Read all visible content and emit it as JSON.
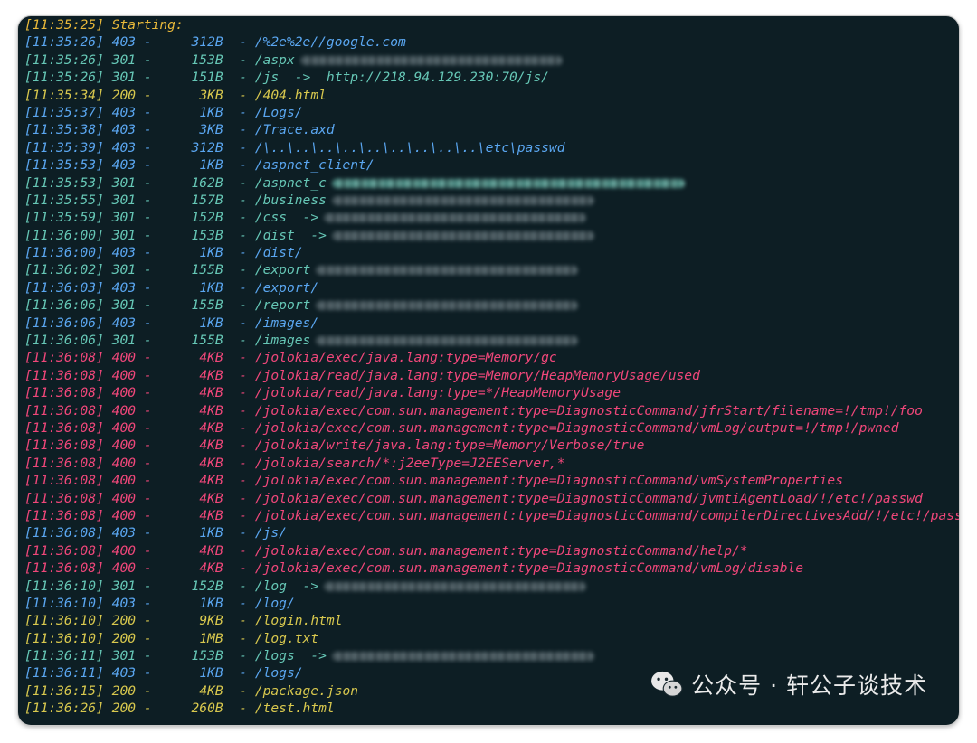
{
  "header": {
    "text": "[11:35:25] Starting:"
  },
  "lines": [
    {
      "time": "[11:35:26]",
      "status": "403",
      "size": "312B",
      "path": "/%2e%2e//google.com",
      "color": "blue",
      "redacted": 0
    },
    {
      "time": "[11:35:26]",
      "status": "301",
      "size": "153B",
      "path": "/aspx",
      "color": "teal",
      "redacted": 1
    },
    {
      "time": "[11:35:26]",
      "status": "301",
      "size": "151B",
      "path": "/js  ->  http://218.94.129.230:70/js/",
      "color": "teal",
      "redacted": 0
    },
    {
      "time": "[11:35:34]",
      "status": "200",
      "size": "3KB",
      "path": "/404.html",
      "color": "yellow",
      "redacted": 0
    },
    {
      "time": "[11:35:37]",
      "status": "403",
      "size": "1KB",
      "path": "/Logs/",
      "color": "blue",
      "redacted": 0
    },
    {
      "time": "[11:35:38]",
      "status": "403",
      "size": "3KB",
      "path": "/Trace.axd",
      "color": "blue",
      "redacted": 0
    },
    {
      "time": "[11:35:39]",
      "status": "403",
      "size": "312B",
      "path": "/\\..\\..\\..\\..\\..\\..\\..\\..\\..\\etc\\passwd",
      "color": "blue",
      "redacted": 0
    },
    {
      "time": "[11:35:53]",
      "status": "403",
      "size": "1KB",
      "path": "/aspnet_client/",
      "color": "blue",
      "redacted": 0
    },
    {
      "time": "[11:35:53]",
      "status": "301",
      "size": "162B",
      "path": "/aspnet_c",
      "color": "teal",
      "redacted": 2
    },
    {
      "time": "[11:35:55]",
      "status": "301",
      "size": "157B",
      "path": "/business",
      "color": "teal",
      "redacted": 1
    },
    {
      "time": "[11:35:59]",
      "status": "301",
      "size": "152B",
      "path": "/css  ->",
      "color": "teal",
      "redacted": 1
    },
    {
      "time": "[11:36:00]",
      "status": "301",
      "size": "153B",
      "path": "/dist  ->",
      "color": "teal",
      "redacted": 1
    },
    {
      "time": "[11:36:00]",
      "status": "403",
      "size": "1KB",
      "path": "/dist/",
      "color": "blue",
      "redacted": 0
    },
    {
      "time": "[11:36:02]",
      "status": "301",
      "size": "155B",
      "path": "/export",
      "color": "teal",
      "redacted": 1
    },
    {
      "time": "[11:36:03]",
      "status": "403",
      "size": "1KB",
      "path": "/export/",
      "color": "blue",
      "redacted": 0
    },
    {
      "time": "[11:36:06]",
      "status": "301",
      "size": "155B",
      "path": "/report",
      "color": "teal",
      "redacted": 1
    },
    {
      "time": "[11:36:06]",
      "status": "403",
      "size": "1KB",
      "path": "/images/",
      "color": "blue",
      "redacted": 0
    },
    {
      "time": "[11:36:06]",
      "status": "301",
      "size": "155B",
      "path": "/images",
      "color": "teal",
      "redacted": 1
    },
    {
      "time": "[11:36:08]",
      "status": "400",
      "size": "4KB",
      "path": "/jolokia/exec/java.lang:type=Memory/gc",
      "color": "red",
      "redacted": 0
    },
    {
      "time": "[11:36:08]",
      "status": "400",
      "size": "4KB",
      "path": "/jolokia/read/java.lang:type=Memory/HeapMemoryUsage/used",
      "color": "red",
      "redacted": 0
    },
    {
      "time": "[11:36:08]",
      "status": "400",
      "size": "4KB",
      "path": "/jolokia/read/java.lang:type=*/HeapMemoryUsage",
      "color": "red",
      "redacted": 0
    },
    {
      "time": "[11:36:08]",
      "status": "400",
      "size": "4KB",
      "path": "/jolokia/exec/com.sun.management:type=DiagnosticCommand/jfrStart/filename=!/tmp!/foo",
      "color": "red",
      "redacted": 0
    },
    {
      "time": "[11:36:08]",
      "status": "400",
      "size": "4KB",
      "path": "/jolokia/exec/com.sun.management:type=DiagnosticCommand/vmLog/output=!/tmp!/pwned",
      "color": "red",
      "redacted": 0
    },
    {
      "time": "[11:36:08]",
      "status": "400",
      "size": "4KB",
      "path": "/jolokia/write/java.lang:type=Memory/Verbose/true",
      "color": "red",
      "redacted": 0
    },
    {
      "time": "[11:36:08]",
      "status": "400",
      "size": "4KB",
      "path": "/jolokia/search/*:j2eeType=J2EEServer,*",
      "color": "red",
      "redacted": 0
    },
    {
      "time": "[11:36:08]",
      "status": "400",
      "size": "4KB",
      "path": "/jolokia/exec/com.sun.management:type=DiagnosticCommand/vmSystemProperties",
      "color": "red",
      "redacted": 0
    },
    {
      "time": "[11:36:08]",
      "status": "400",
      "size": "4KB",
      "path": "/jolokia/exec/com.sun.management:type=DiagnosticCommand/jvmtiAgentLoad/!/etc!/passwd",
      "color": "red",
      "redacted": 0
    },
    {
      "time": "[11:36:08]",
      "status": "400",
      "size": "4KB",
      "path": "/jolokia/exec/com.sun.management:type=DiagnosticCommand/compilerDirectivesAdd/!/etc!/passwd",
      "color": "red",
      "redacted": 0
    },
    {
      "time": "[11:36:08]",
      "status": "403",
      "size": "1KB",
      "path": "/js/",
      "color": "blue",
      "redacted": 0
    },
    {
      "time": "[11:36:08]",
      "status": "400",
      "size": "4KB",
      "path": "/jolokia/exec/com.sun.management:type=DiagnosticCommand/help/*",
      "color": "red",
      "redacted": 0
    },
    {
      "time": "[11:36:08]",
      "status": "400",
      "size": "4KB",
      "path": "/jolokia/exec/com.sun.management:type=DiagnosticCommand/vmLog/disable",
      "color": "red",
      "redacted": 0
    },
    {
      "time": "[11:36:10]",
      "status": "301",
      "size": "152B",
      "path": "/log  ->",
      "color": "teal",
      "redacted": 1
    },
    {
      "time": "[11:36:10]",
      "status": "403",
      "size": "1KB",
      "path": "/log/",
      "color": "blue",
      "redacted": 0
    },
    {
      "time": "[11:36:10]",
      "status": "200",
      "size": "9KB",
      "path": "/login.html",
      "color": "yellow",
      "redacted": 0
    },
    {
      "time": "[11:36:10]",
      "status": "200",
      "size": "1MB",
      "path": "/log.txt",
      "color": "yellow",
      "redacted": 0
    },
    {
      "time": "[11:36:11]",
      "status": "301",
      "size": "153B",
      "path": "/logs  ->",
      "color": "teal",
      "redacted": 1
    },
    {
      "time": "[11:36:11]",
      "status": "403",
      "size": "1KB",
      "path": "/logs/",
      "color": "blue",
      "redacted": 0
    },
    {
      "time": "[11:36:15]",
      "status": "200",
      "size": "4KB",
      "path": "/package.json",
      "color": "yellow",
      "redacted": 0
    },
    {
      "time": "[11:36:26]",
      "status": "200",
      "size": "260B",
      "path": "/test.html",
      "color": "yellow",
      "redacted": 0
    }
  ],
  "watermark": {
    "text": "公众号 · 轩公子谈技术",
    "icon": "wechat-icon"
  }
}
